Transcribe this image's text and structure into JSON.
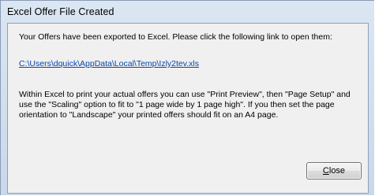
{
  "window": {
    "title": "Excel Offer File Created"
  },
  "dialog": {
    "message_line1": "Your Offers have been exported to Excel. Please click the following link to open them:",
    "link_text": "C:\\Users\\dquick\\AppData\\Local\\Temp\\Izly2tev.xls",
    "message_instructions": "Within Excel to print your actual offers you can use \"Print Preview\", then \"Page Setup\" and use the \"Scaling\" option to fit to \"1 page wide by 1 page high\". If you then set the page orientation to \"Landscape\" your printed offers should fit on an A4 page.",
    "close_button": {
      "mnemonic": "C",
      "rest": "lose"
    }
  }
}
